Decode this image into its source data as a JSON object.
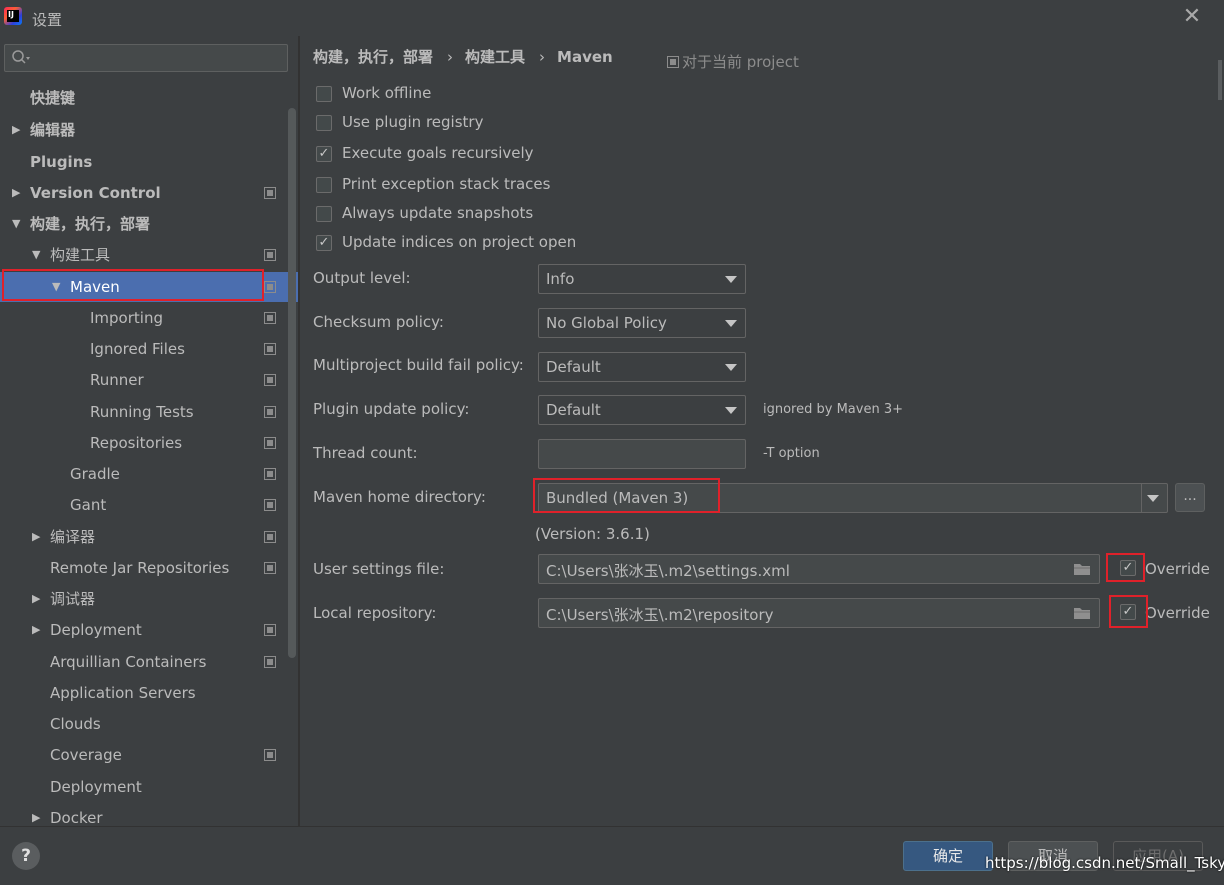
{
  "window": {
    "title": "设置",
    "close": "✕"
  },
  "sidebar": {
    "search_placeholder": "",
    "items": [
      {
        "label": "快捷键"
      },
      {
        "label": "编辑器",
        "arrow": "▶"
      },
      {
        "label": "Plugins"
      },
      {
        "label": "Version Control",
        "arrow": "▶"
      },
      {
        "label": "构建，执行，部署",
        "arrow": "▼"
      },
      {
        "label": "构建工具",
        "arrow": "▼"
      },
      {
        "label": "Maven",
        "arrow": "▼"
      },
      {
        "label": "Importing"
      },
      {
        "label": "Ignored Files"
      },
      {
        "label": "Runner"
      },
      {
        "label": "Running Tests"
      },
      {
        "label": "Repositories"
      },
      {
        "label": "Gradle"
      },
      {
        "label": "Gant"
      },
      {
        "label": "编译器",
        "arrow": "▶"
      },
      {
        "label": "Remote Jar Repositories"
      },
      {
        "label": "调试器",
        "arrow": "▶"
      },
      {
        "label": "Deployment",
        "arrow": "▶"
      },
      {
        "label": "Arquillian Containers"
      },
      {
        "label": "Application Servers"
      },
      {
        "label": "Clouds"
      },
      {
        "label": "Coverage"
      },
      {
        "label": "Deployment"
      },
      {
        "label": "Docker",
        "arrow": "▶"
      }
    ]
  },
  "breadcrumb": {
    "parts": [
      "构建，执行，部署",
      "构建工具",
      "Maven"
    ],
    "separator": "›",
    "scope": "对于当前 project"
  },
  "checkboxes": [
    {
      "label": "Work offline",
      "checked": false
    },
    {
      "label": "Use plugin registry",
      "checked": false
    },
    {
      "label": "Execute goals recursively",
      "checked": true
    },
    {
      "label": "Print exception stack traces",
      "checked": false
    },
    {
      "label": "Always update snapshots",
      "checked": false
    },
    {
      "label": "Update indices on project open",
      "checked": true
    }
  ],
  "form": {
    "output_level": {
      "label": "Output level:",
      "value": "Info"
    },
    "checksum_policy": {
      "label": "Checksum policy:",
      "value": "No Global Policy"
    },
    "multiproject_policy": {
      "label": "Multiproject build fail policy:",
      "value": "Default"
    },
    "plugin_update_policy": {
      "label": "Plugin update policy:",
      "value": "Default",
      "hint": "ignored by Maven 3+"
    },
    "thread_count": {
      "label": "Thread count:",
      "value": "",
      "hint": "-T option"
    },
    "maven_home": {
      "label": "Maven home directory:",
      "value": "Bundled (Maven 3)",
      "browse": "...",
      "version": "(Version: 3.6.1)"
    },
    "user_settings": {
      "label": "User settings file:",
      "value": "C:\\Users\\张冰玉\\.m2\\settings.xml",
      "override_label": "Override",
      "override_checked": true
    },
    "local_repo": {
      "label": "Local repository:",
      "value": "C:\\Users\\张冰玉\\.m2\\repository",
      "override_label": "Override",
      "override_checked": true
    }
  },
  "footer": {
    "help": "?",
    "ok": "确定",
    "cancel": "取消",
    "apply": "应用(A)",
    "watermark": "https://blog.csdn.net/Small_Tsky"
  },
  "colors": {
    "background": "#3c3f41",
    "selection": "#4b6eaf",
    "highlight_box": "#e0212a",
    "ok_button": "#365880"
  }
}
